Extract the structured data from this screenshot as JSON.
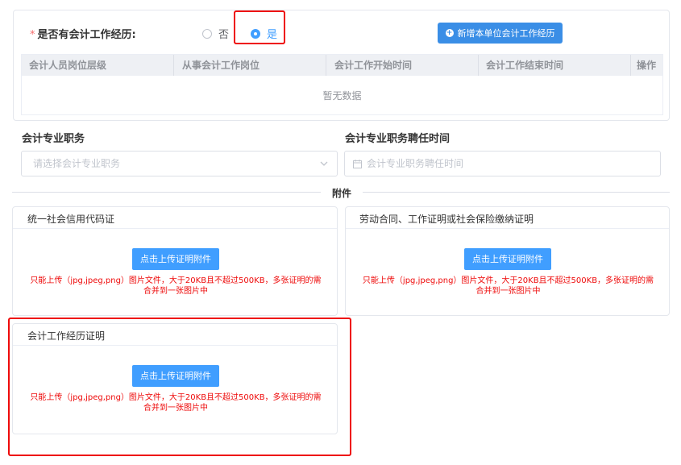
{
  "experience": {
    "required_mark": "*",
    "label": "是否有会计工作经历:",
    "options": {
      "no": "否",
      "yes": "是"
    },
    "selected": "yes",
    "add_button": "新增本单位会计工作经历",
    "table": {
      "columns": [
        "会计人员岗位层级",
        "从事会计工作岗位",
        "会计工作开始时间",
        "会计工作结束时间",
        "操作"
      ],
      "rows": [],
      "empty_text": "暂无数据"
    }
  },
  "professional": {
    "title_label": "会计专业职务",
    "title_placeholder": "请选择会计专业职务",
    "appoint_label": "会计专业职务聘任时间",
    "appoint_placeholder": "会计专业职务聘任时间"
  },
  "attachments": {
    "divider": "附件",
    "cards": [
      {
        "title": "统一社会信用代码证",
        "button": "点击上传证明附件",
        "hint_line1": "只能上传（jpg,jpeg,png）图片文件，大于20KB且不超过500KB，多张证明的需",
        "hint_line2": "合并到一张图片中"
      },
      {
        "title": "劳动合同、工作证明或社会保险缴纳证明",
        "button": "点击上传证明附件",
        "hint_line1": "只能上传（jpg,jpeg,png）图片文件，大于20KB且不超过500KB，多张证明的需",
        "hint_line2": "合并到一张图片中"
      },
      {
        "title": "会计工作经历证明",
        "button": "点击上传证明附件",
        "hint_line1": "只能上传（jpg,jpeg,png）图片文件，大于20KB且不超过500KB，多张证明的需",
        "hint_line2": "合并到一张图片中"
      }
    ]
  },
  "colors": {
    "primary": "#409eff",
    "highlight_red": "#ee0a0a",
    "required_red": "#f56c6c"
  }
}
